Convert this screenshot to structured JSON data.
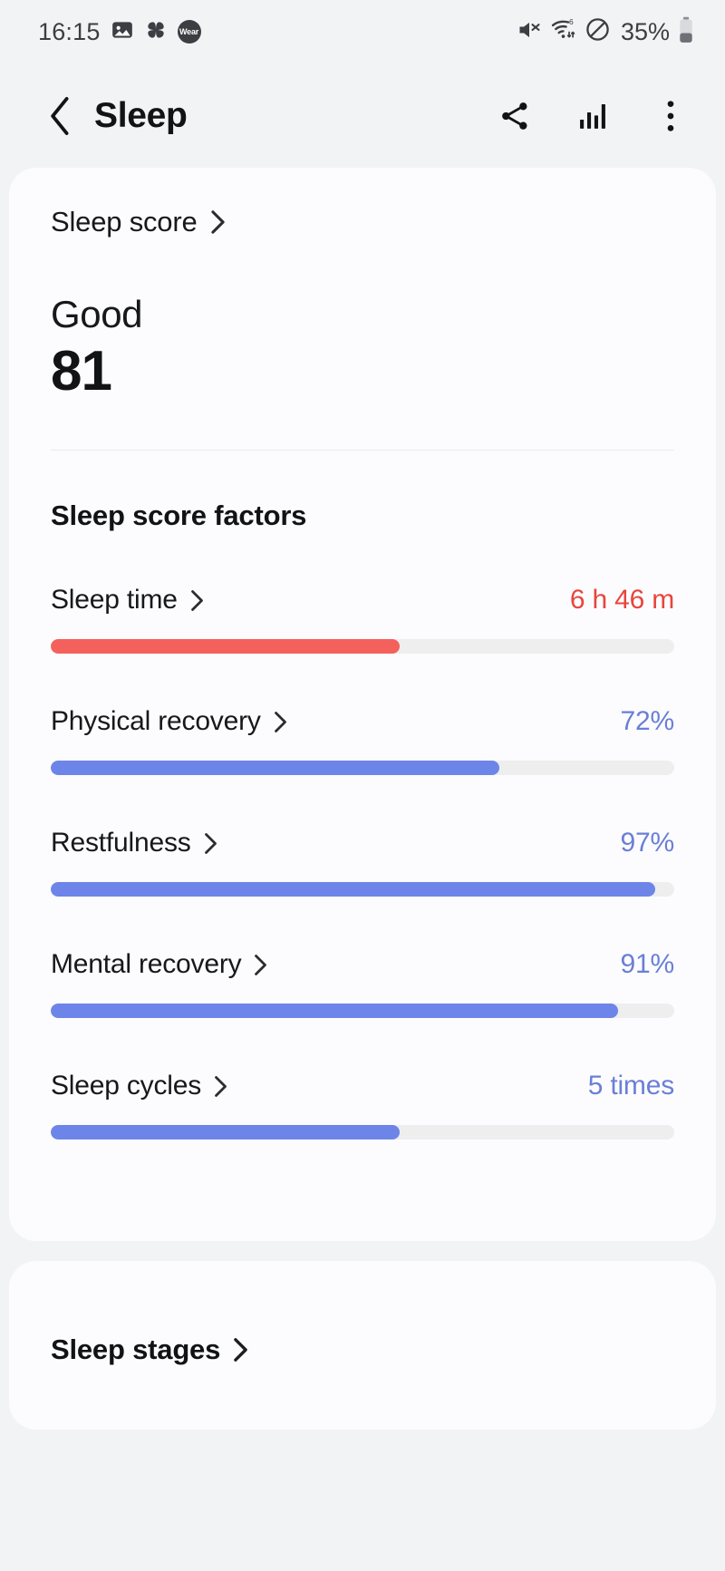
{
  "status_bar": {
    "time": "16:15",
    "left_icons": [
      "photo-icon",
      "pinwheel-icon",
      "wear-badge"
    ],
    "wear_label": "Wear",
    "right_icons": [
      "mute-icon",
      "wifi6-icon",
      "do-not-disturb-icon"
    ],
    "battery_percent": "35%"
  },
  "app_bar": {
    "title": "Sleep",
    "back_icon": "chevron-left-icon",
    "actions": [
      "share-icon",
      "bar-chart-icon",
      "overflow-menu-icon"
    ]
  },
  "score_card": {
    "header_label": "Sleep score",
    "grade": "Good",
    "value": "81",
    "factors_title": "Sleep score factors",
    "factors": [
      {
        "name": "Sleep time",
        "value": "6 h 46 m",
        "percent": 56,
        "tone": "red"
      },
      {
        "name": "Physical recovery",
        "value": "72%",
        "percent": 72,
        "tone": "blue"
      },
      {
        "name": "Restfulness",
        "value": "97%",
        "percent": 97,
        "tone": "blue"
      },
      {
        "name": "Mental recovery",
        "value": "91%",
        "percent": 91,
        "tone": "blue"
      },
      {
        "name": "Sleep cycles",
        "value": "5 times",
        "percent": 56,
        "tone": "blue"
      }
    ]
  },
  "stages_card": {
    "title": "Sleep stages"
  },
  "colors": {
    "accent_blue": "#6d85e8",
    "accent_blue_text": "#6a7fd6",
    "warning_red": "#f4615c",
    "warning_red_text": "#e8453c",
    "track": "#eeeeef",
    "page_bg": "#f2f3f5",
    "card_bg": "#fcfcfe"
  }
}
